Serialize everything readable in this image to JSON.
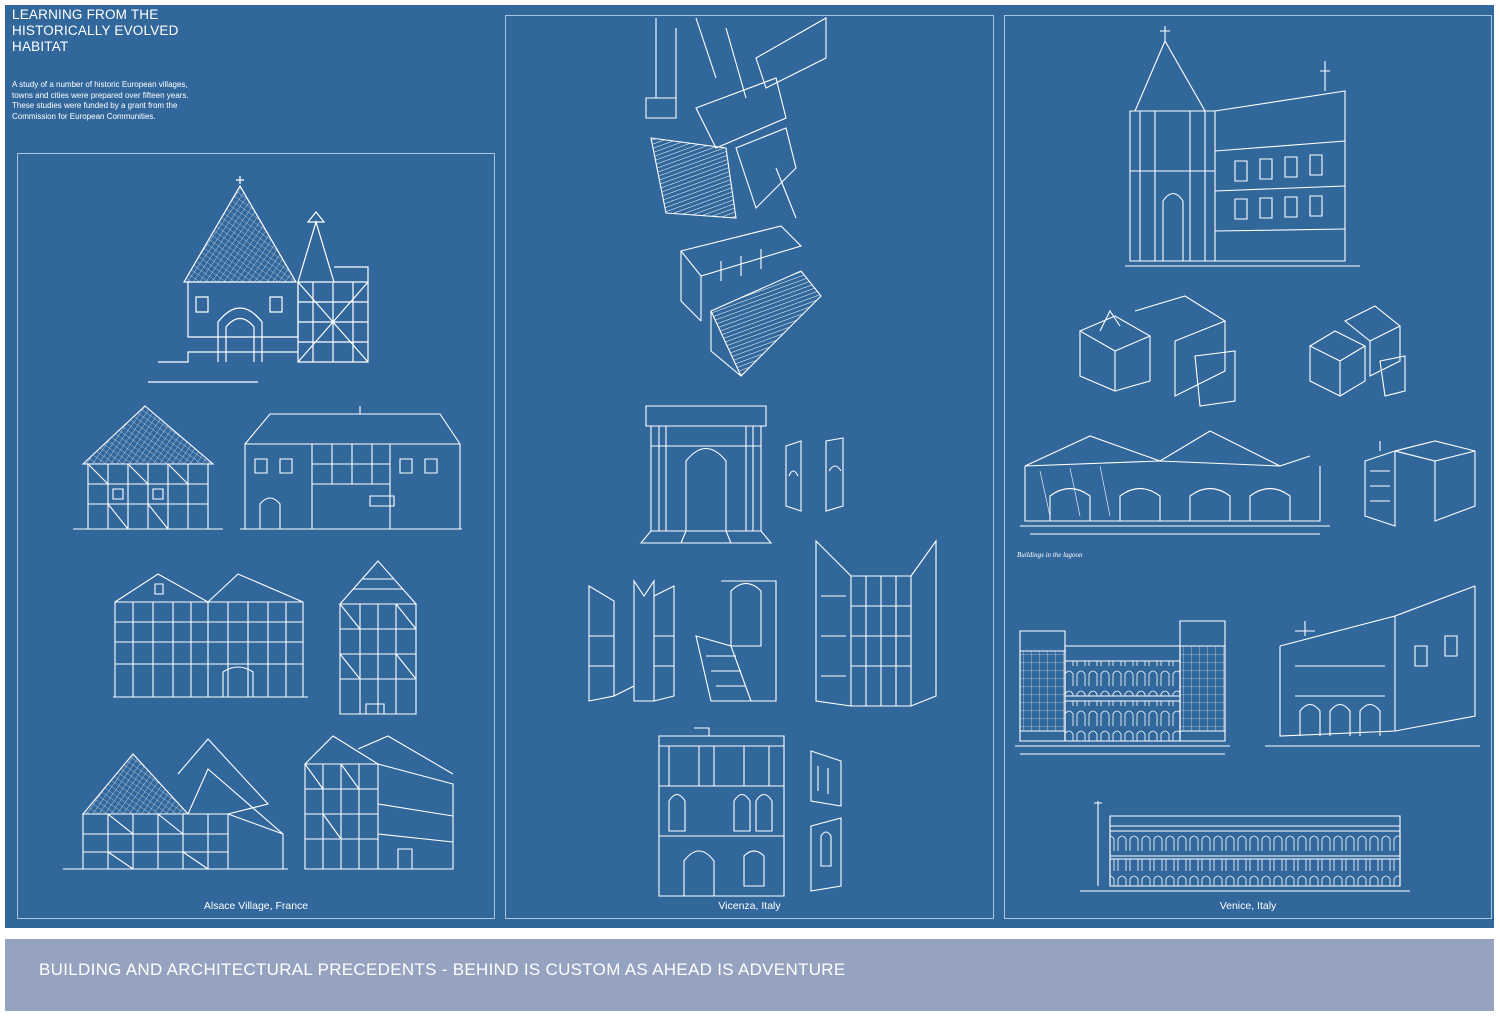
{
  "intro": {
    "title": "LEARNING FROM THE HISTORICALLY EVOLVED HABITAT",
    "text": "A study of a number of historic European villages, towns and cities were prepared over fifteen years. These studies were funded by a grant from the Commission for European Communities."
  },
  "panels": {
    "alsace": {
      "caption": "Alsace Village, France"
    },
    "vicenza": {
      "caption": "Vicenza, Italy"
    },
    "venice": {
      "caption": "Venice, Italy",
      "sketch_note": "Buildings in the lagoon"
    }
  },
  "footer": {
    "text": "BUILDING AND ARCHITECTURAL PRECEDENTS - BEHIND IS CUSTOM AS AHEAD IS ADVENTURE"
  },
  "colors": {
    "board": "#32679c",
    "line": "#ffffff",
    "panel_border": "#a9c4df",
    "footer": "#95a3c0"
  }
}
